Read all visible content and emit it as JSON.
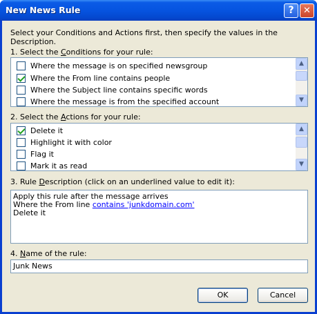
{
  "window": {
    "title": "New News Rule"
  },
  "titlebar": {
    "help": "?",
    "close": "✕"
  },
  "intro": "Select your Conditions and Actions first, then specify the values in the Description.",
  "conditions": {
    "label_pre": "1. Select the ",
    "label_accel": "C",
    "label_post": "onditions for your rule:",
    "items": [
      {
        "text": "Where the message is on specified newsgroup",
        "checked": false
      },
      {
        "text": "Where the From line contains people",
        "checked": true
      },
      {
        "text": "Where the Subject line contains specific words",
        "checked": false
      },
      {
        "text": "Where the message is from the specified account",
        "checked": false
      }
    ]
  },
  "actions": {
    "label_pre": "2. Select the ",
    "label_accel": "A",
    "label_post": "ctions for your rule:",
    "items": [
      {
        "text": "Delete it",
        "checked": true
      },
      {
        "text": "Highlight it with color",
        "checked": false
      },
      {
        "text": "Flag it",
        "checked": false
      },
      {
        "text": "Mark it as read",
        "checked": false
      }
    ]
  },
  "description": {
    "label_pre": "3. Rule ",
    "label_accel": "D",
    "label_post": "escription (click on an underlined value to edit it):",
    "line1": "Apply this rule after the message arrives",
    "line2_prefix": "Where the From line ",
    "line2_link": "contains 'junkdomain.com'",
    "line3": "Delete it"
  },
  "name": {
    "label_pre": "4. ",
    "label_accel": "N",
    "label_post": "ame of the rule:",
    "value": "Junk News"
  },
  "buttons": {
    "ok": "OK",
    "cancel": "Cancel"
  },
  "scroll": {
    "up": "▲",
    "down": "▼"
  }
}
